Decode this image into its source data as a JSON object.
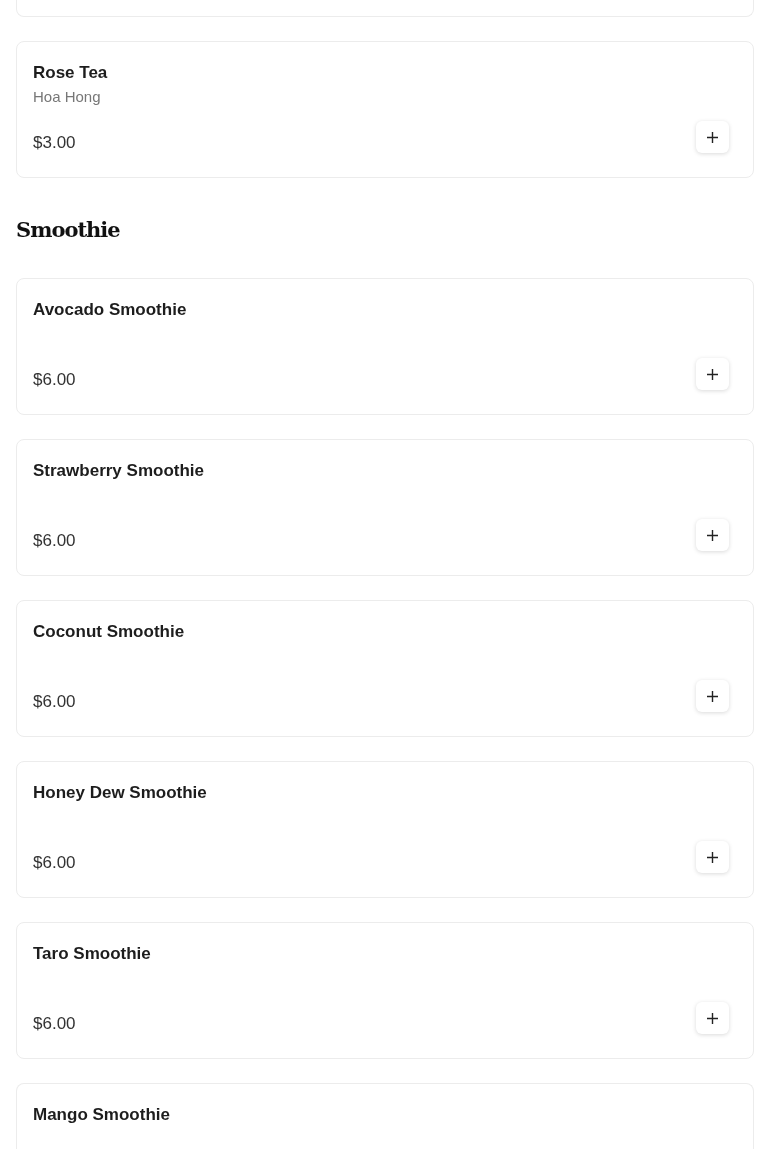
{
  "sections": [
    {
      "items": [
        {
          "name": "Rose Tea",
          "subtitle": "Hoa Hong",
          "price": "$3.00"
        }
      ]
    },
    {
      "title": "Smoothie",
      "items": [
        {
          "name": "Avocado Smoothie",
          "price": "$6.00"
        },
        {
          "name": "Strawberry Smoothie",
          "price": "$6.00"
        },
        {
          "name": "Coconut Smoothie",
          "price": "$6.00"
        },
        {
          "name": "Honey Dew Smoothie",
          "price": "$6.00"
        },
        {
          "name": "Taro Smoothie",
          "price": "$6.00"
        },
        {
          "name": "Mango Smoothie"
        }
      ]
    }
  ]
}
